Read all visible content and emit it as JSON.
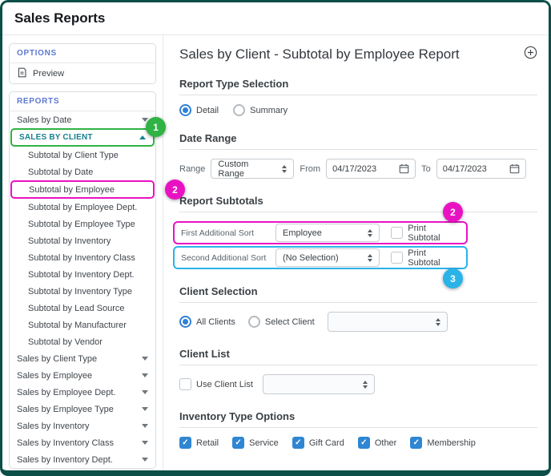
{
  "window": {
    "title": "Sales Reports"
  },
  "sidebar": {
    "options_header": "OPTIONS",
    "preview_label": "Preview",
    "reports_header": "REPORTS",
    "sales_by_date": "Sales by Date",
    "active_report": "SALES BY CLIENT",
    "subitems": [
      "Subtotal by Client Type",
      "Subtotal by Date",
      "Subtotal by Employee",
      "Subtotal by Employee Dept.",
      "Subtotal by Employee Type",
      "Subtotal by Inventory",
      "Subtotal by Inventory Class",
      "Subtotal by Inventory Dept.",
      "Subtotal by Inventory Type",
      "Subtotal by Lead Source",
      "Subtotal by Manufacturer",
      "Subtotal by Vendor"
    ],
    "collapsed_reports": [
      "Sales by Client Type",
      "Sales by Employee",
      "Sales by Employee Dept.",
      "Sales by Employee Type",
      "Sales by Inventory",
      "Sales by Inventory Class",
      "Sales by Inventory Dept."
    ]
  },
  "main": {
    "title": "Sales by Client - Subtotal by Employee Report",
    "report_type": {
      "heading": "Report Type Selection",
      "detail": "Detail",
      "summary": "Summary",
      "selected": "Detail"
    },
    "date_range": {
      "heading": "Date Range",
      "range_label": "Range",
      "range_value": "Custom Range",
      "from_label": "From",
      "from_value": "04/17/2023",
      "to_label": "To",
      "to_value": "04/17/2023"
    },
    "subtotals": {
      "heading": "Report Subtotals",
      "first_label": "First Additional Sort",
      "first_value": "Employee",
      "second_label": "Second Additional Sort",
      "second_value": "(No Selection)",
      "print_subtotal": "Print Subtotal"
    },
    "client_selection": {
      "heading": "Client Selection",
      "all_clients": "All Clients",
      "select_client": "Select Client",
      "selected": "All Clients"
    },
    "client_list": {
      "heading": "Client List",
      "use_client_list": "Use Client List"
    },
    "inventory": {
      "heading": "Inventory Type Options",
      "options": [
        "Retail",
        "Service",
        "Gift Card",
        "Other",
        "Membership"
      ],
      "checked": [
        "Retail",
        "Service",
        "Gift Card",
        "Other",
        "Membership"
      ]
    }
  },
  "annotations": {
    "step1": "1",
    "step2": "2",
    "step3": "3"
  },
  "colors": {
    "frame_border": "#0b4f48",
    "accent_blue": "#2f80d9",
    "checkbox_blue": "#2f86d2",
    "sidebar_header_blue": "#5d78d1",
    "active_report_teal": "#17808f",
    "annotation_green": "#2fb344",
    "annotation_magenta": "#e912c3",
    "annotation_cyan": "#2ab3e8"
  }
}
